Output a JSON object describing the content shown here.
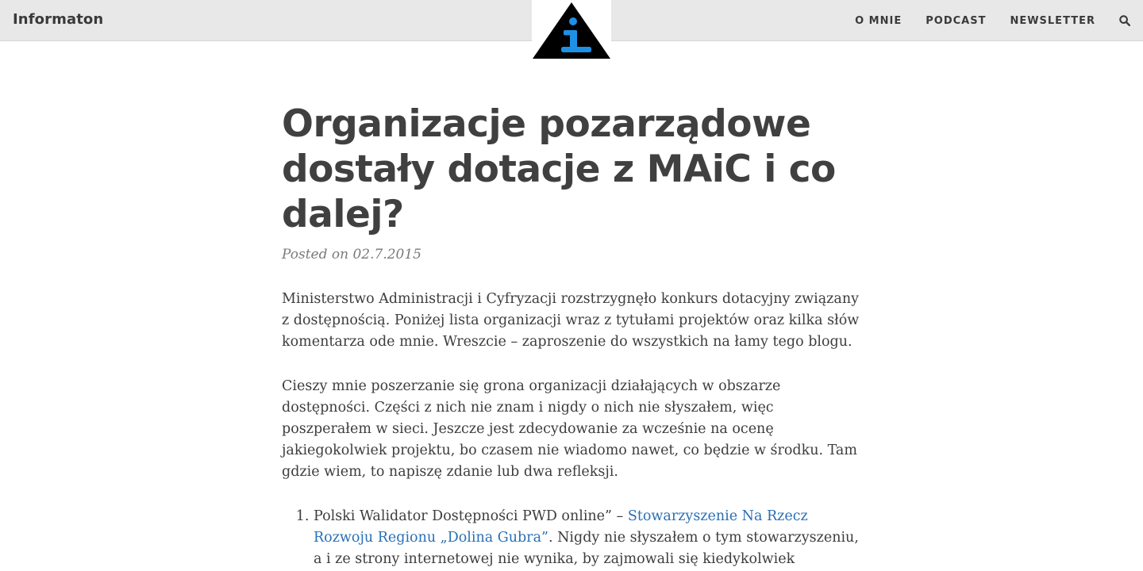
{
  "header": {
    "site_title": "Informaton",
    "nav": [
      {
        "label": "O MNIE"
      },
      {
        "label": "PODCAST"
      },
      {
        "label": "NEWSLETTER"
      }
    ],
    "search_icon": "search-icon",
    "logo_icon": "info-triangle-logo",
    "colors": {
      "bar_bg": "#e8e8e8",
      "logo_triangle": "#000000",
      "logo_i": "#1e90e6",
      "link": "#2a6fb5"
    }
  },
  "article": {
    "title": "Organizacje pozarządowe dostały dotacje z MAiC i co dalej?",
    "meta": "Posted on 02.7.2015",
    "paragraphs": [
      "Ministerstwo Administracji i Cyfryzacji rozstrzygnęło konkurs dotacyjny związany z dostępnością. Poniżej lista organizacji wraz z tytułami projektów oraz kilka słów komentarza ode mnie. Wreszcie – zaproszenie do wszystkich na łamy tego blogu.",
      "Cieszy mnie poszerzanie się grona organizacji działających w obszarze dostępności. Części z nich nie znam i nigdy o nich nie słyszałem, więc poszperałem w sieci. Jeszcze jest zdecydowanie za wcześnie na ocenę jakiegokolwiek projektu, bo czasem nie wiadomo nawet, co będzie w środku. Tam gdzie wiem, to napiszę zdanie lub dwa refleksji."
    ],
    "list": [
      {
        "prefix": "Polski Walidator Dostępności PWD online” – ",
        "link_text": "Stowarzyszenie Na Rzecz Rozwoju Regionu „Dolina Gubra”",
        "suffix": ". Nigdy nie słyszałem o tym stowarzyszeniu, a i ze strony internetowej nie wynika, by zajmowali się kiedykolwiek dostępnością. Tytuł"
      }
    ]
  }
}
